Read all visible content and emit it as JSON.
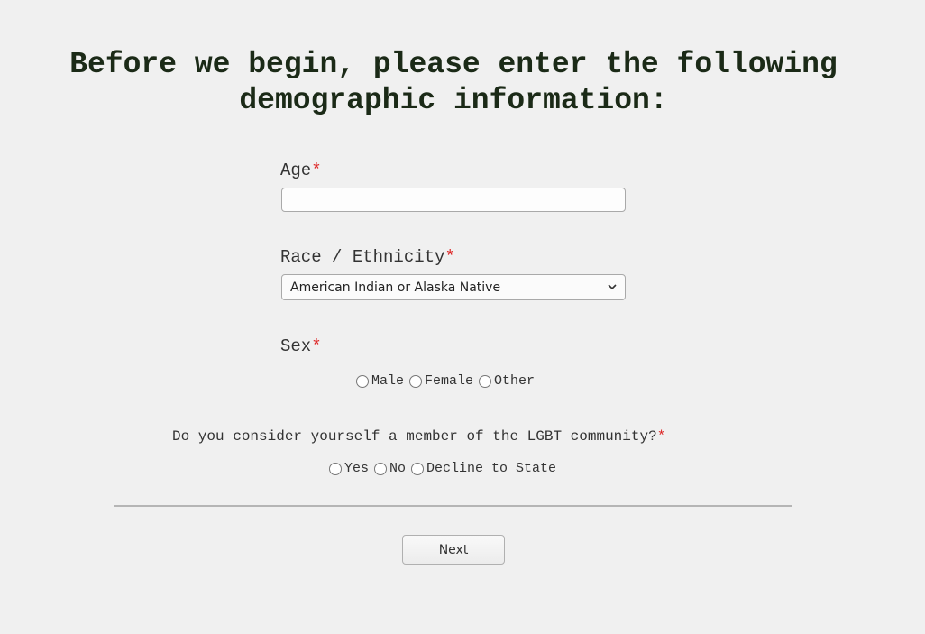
{
  "page": {
    "title_line1": "Before we begin, please enter the following",
    "title_line2": "demographic information:"
  },
  "form": {
    "age": {
      "label": "Age",
      "required_mark": "*",
      "value": "",
      "placeholder": ""
    },
    "race": {
      "label": "Race / Ethnicity",
      "required_mark": "*",
      "selected": "American Indian or Alaska Native"
    },
    "sex": {
      "label": "Sex",
      "required_mark": "*",
      "options": [
        "Male",
        "Female",
        "Other"
      ]
    },
    "lgbt": {
      "label": "Do you consider yourself a member of the LGBT community?",
      "required_mark": "*",
      "options": [
        "Yes",
        "No",
        "Decline to State"
      ]
    }
  },
  "actions": {
    "next_label": "Next"
  },
  "colors": {
    "background": "#f0f0f0",
    "title": "#1b2a17",
    "required": "#dd2222"
  },
  "icons": {
    "select": "chevron-down-icon",
    "radio": "radio-unchecked-icon"
  }
}
